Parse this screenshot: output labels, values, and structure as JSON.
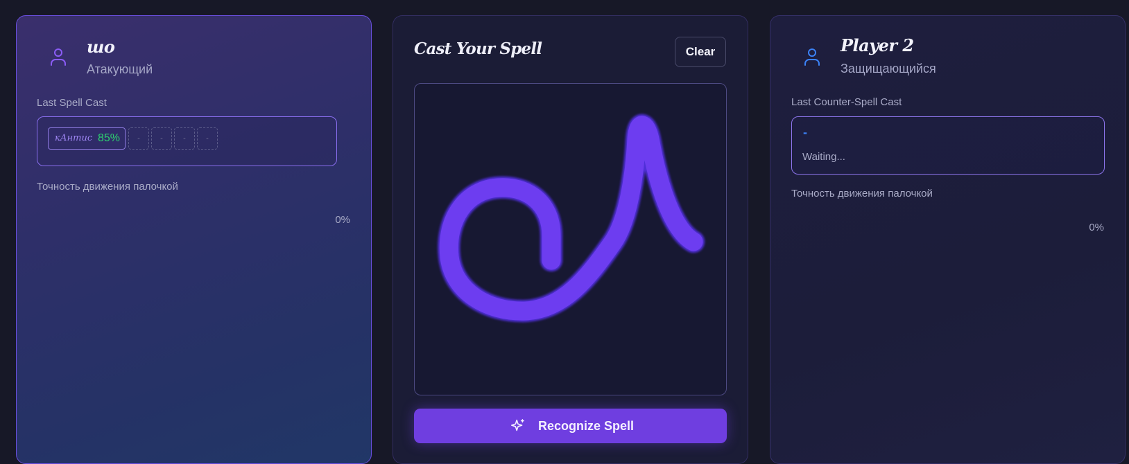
{
  "player1": {
    "name": "шо",
    "role": "Атакующий",
    "last_spell_label": "Last Spell Cast",
    "spell_chip": {
      "name": "кАнтис",
      "accuracy": "85%"
    },
    "empty_slots": [
      "-",
      "-",
      "-",
      "-"
    ],
    "wand_accuracy_label": "Точность движения палочкой",
    "wand_accuracy_value": "0%",
    "accent_color": "#8b5cf6"
  },
  "cast_panel": {
    "title": "Cast Your Spell",
    "clear_label": "Clear",
    "recognize_label": "Recognize Spell",
    "stroke_color": "#6d3df0"
  },
  "player2": {
    "name": "Player 2",
    "role": "Защищающийся",
    "last_spell_label": "Last Counter-Spell Cast",
    "spell_placeholder": "-",
    "waiting_text": "Waiting...",
    "wand_accuracy_label": "Точность движения палочкой",
    "wand_accuracy_value": "0%",
    "accent_color": "#3b82f6"
  }
}
